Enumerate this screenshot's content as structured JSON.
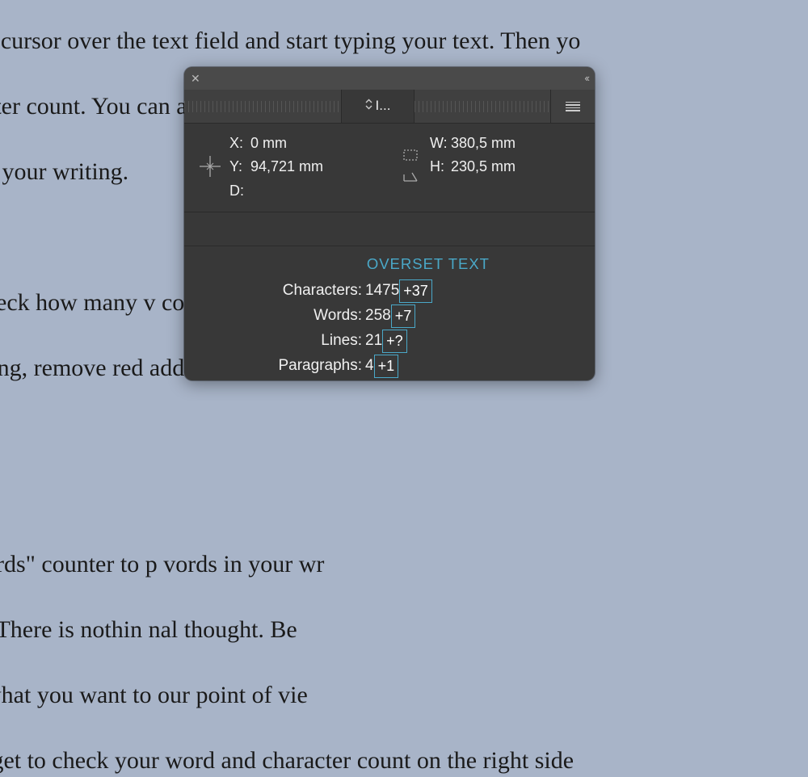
{
  "background": {
    "line1": "e cursor over the text field and start typing your text. Then yo",
    "line2": "cter count. You can also estimate precisely how many sentenc",
    "line3": "n your writing.",
    "line4": "",
    "line5": "heck how many v                                                    copy-paste it fr",
    "line6": "ting, remove red                                                      add new conten",
    "line7": "",
    "line8": "",
    "line9": "ords\" counter to p                                                  vords in your wr",
    "line10": ". There is nothin                                                      nal thought. Be",
    "line11": "what you want to                                                   our point of vie",
    "line12": "rget to check your word and character count on the right side"
  },
  "panel": {
    "tab_label": "I...",
    "coords": {
      "x": {
        "label": "X:",
        "value": "0 mm"
      },
      "y": {
        "label": "Y:",
        "value": "94,721 mm"
      },
      "d": {
        "label": "D:",
        "value": ""
      },
      "w": {
        "label": "W:",
        "value": "380,5 mm"
      },
      "h": {
        "label": "H:",
        "value": "230,5 mm"
      }
    },
    "overset_label": "OVERSET TEXT",
    "stats": {
      "characters": {
        "label": "Characters:",
        "value": "1475",
        "over": "+37"
      },
      "words": {
        "label": "Words:",
        "value": "258",
        "over": "+7"
      },
      "lines": {
        "label": "Lines:",
        "value": "21",
        "over": "+?"
      },
      "paragraphs": {
        "label": "Paragraphs:",
        "value": "4",
        "over": "+1"
      }
    }
  }
}
